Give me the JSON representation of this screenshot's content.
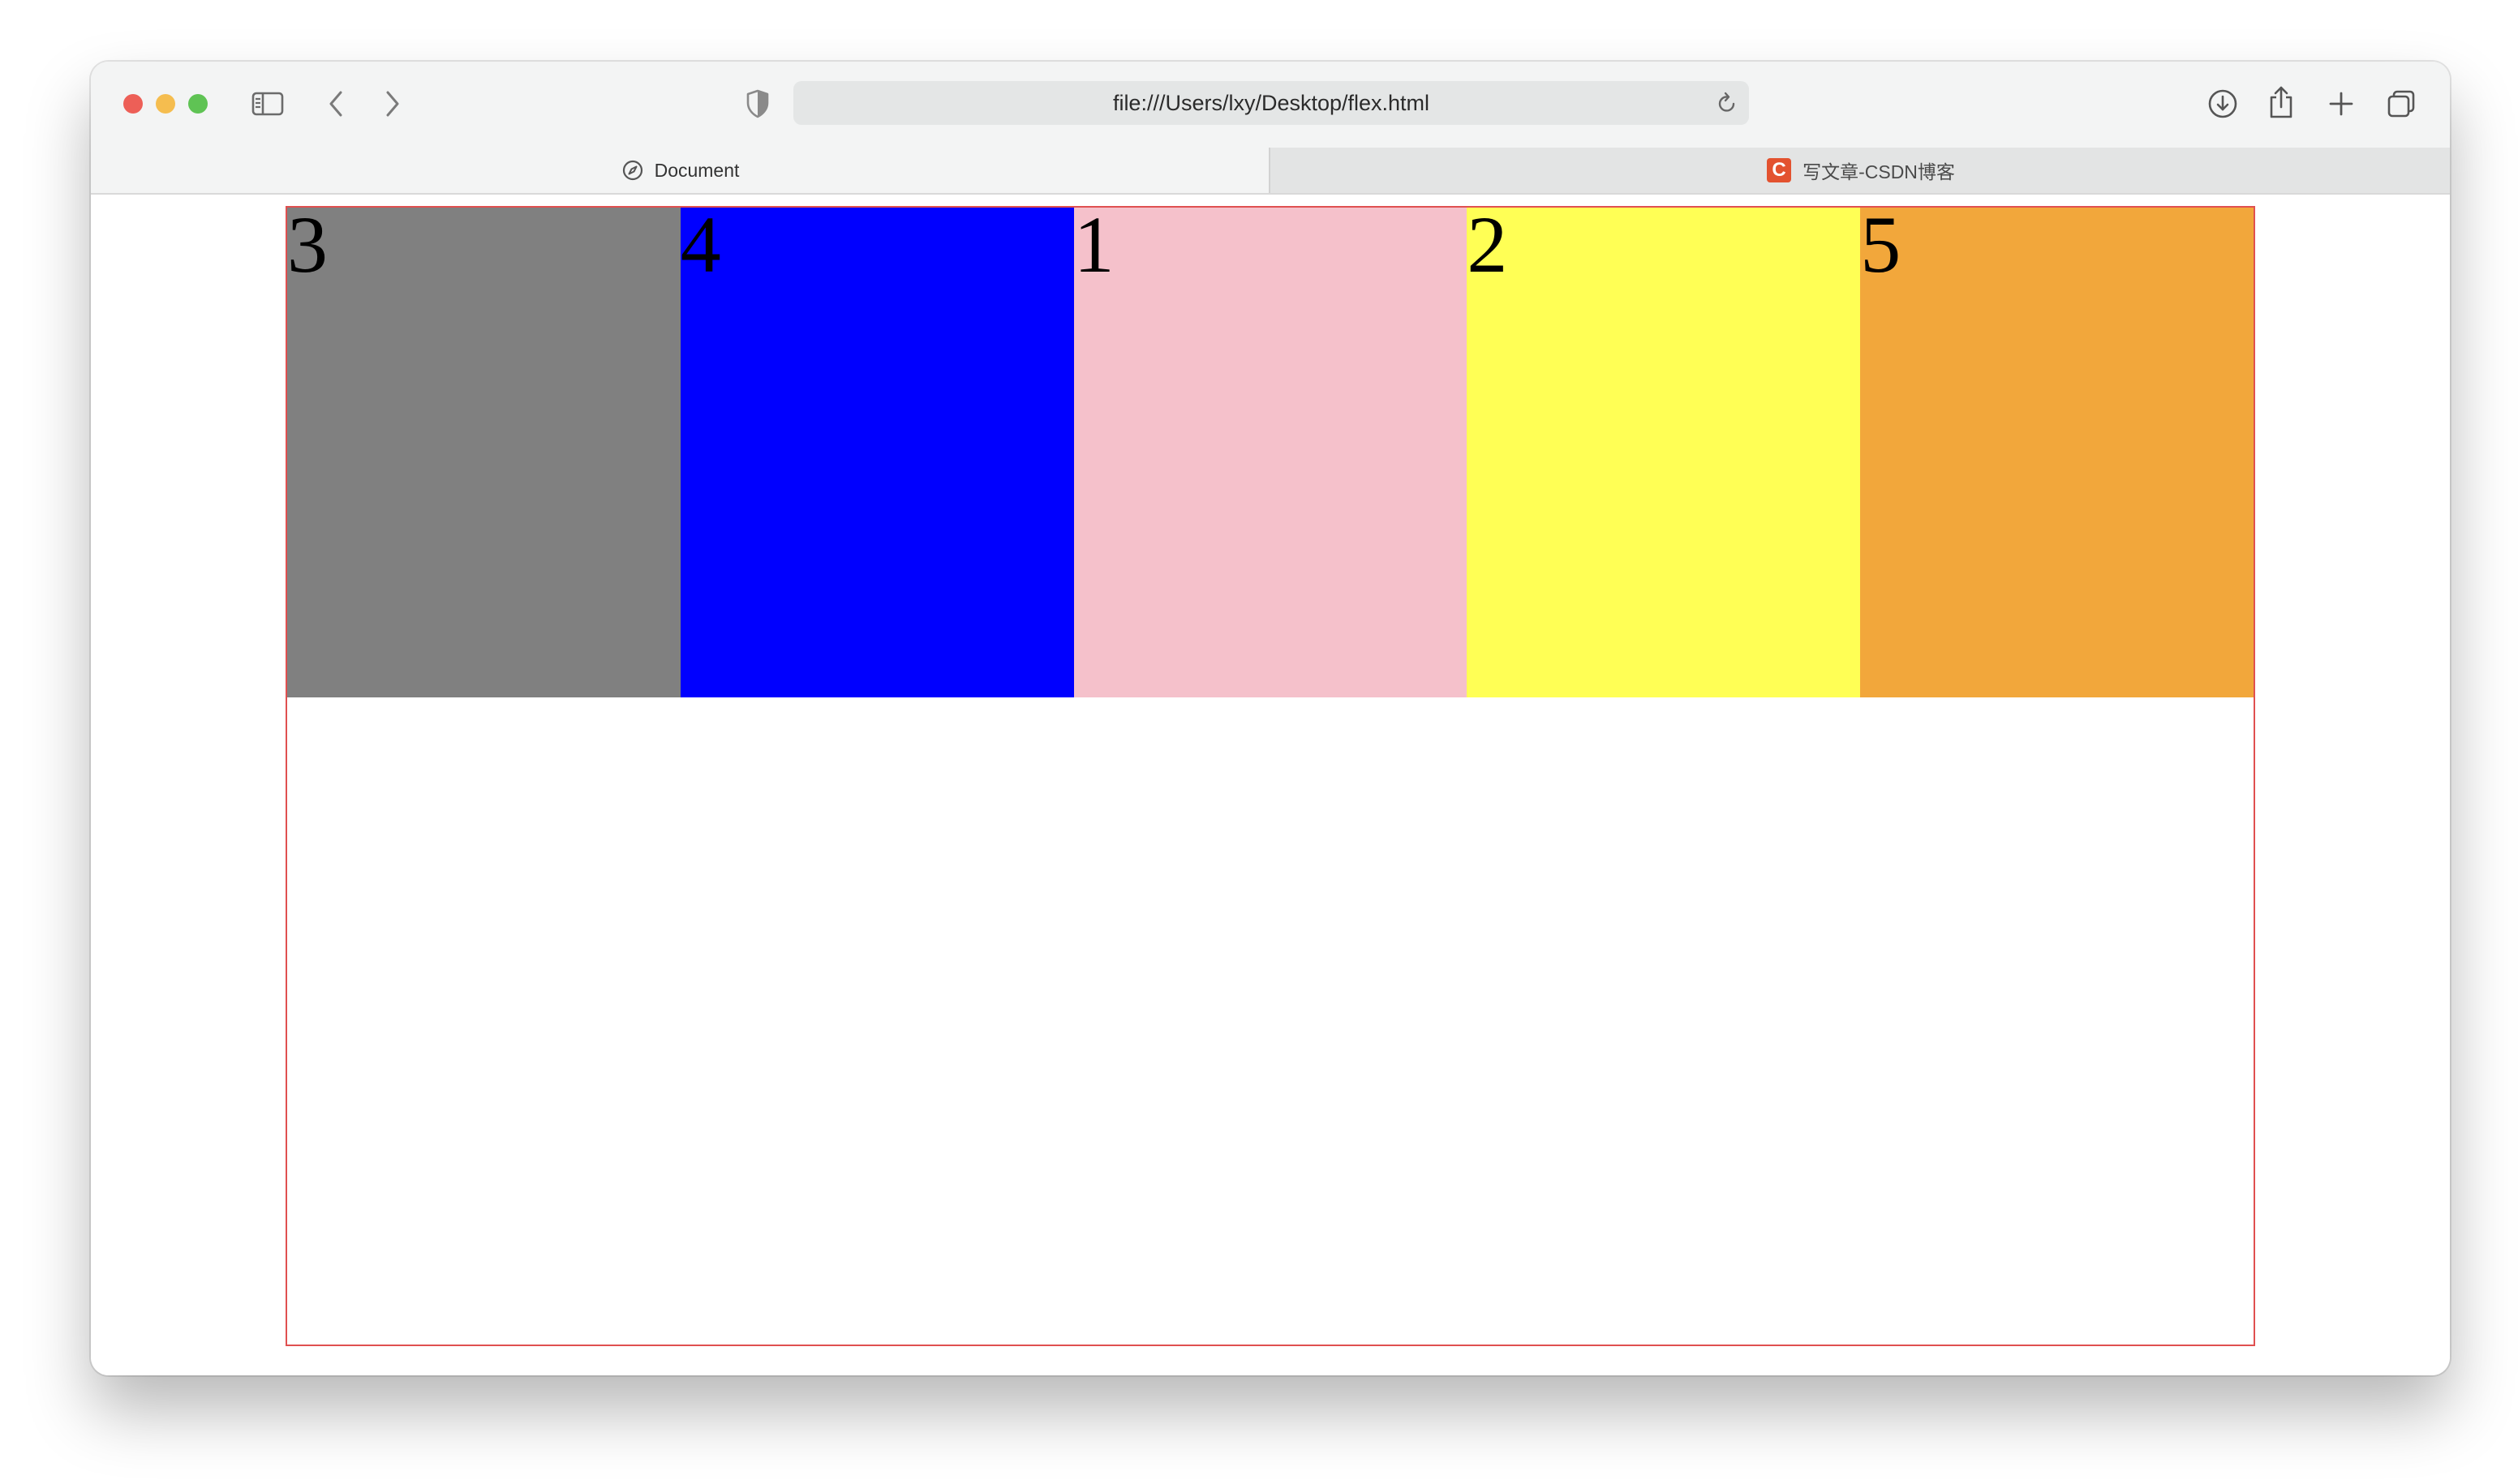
{
  "browser": {
    "url": "file:///Users/lxy/Desktop/flex.html",
    "tabs": [
      {
        "title": "Document",
        "active": true,
        "icon": "compass-icon"
      },
      {
        "title": "写文章-CSDN博客",
        "active": false,
        "icon": "csdn-favicon",
        "favicon_letter": "C"
      }
    ],
    "toolbar_icons": [
      "sidebar-icon",
      "back-icon",
      "forward-icon",
      "shield-icon",
      "reload-icon",
      "download-icon",
      "share-icon",
      "new-tab-icon",
      "tab-overview-icon"
    ]
  },
  "page": {
    "container_border_color": "#e05050",
    "items": [
      {
        "label": "3",
        "color": "#808080"
      },
      {
        "label": "4",
        "color": "#0000ff"
      },
      {
        "label": "1",
        "color": "#f5c1cb"
      },
      {
        "label": "2",
        "color": "#ffff55"
      },
      {
        "label": "5",
        "color": "#f2a73b"
      }
    ]
  }
}
